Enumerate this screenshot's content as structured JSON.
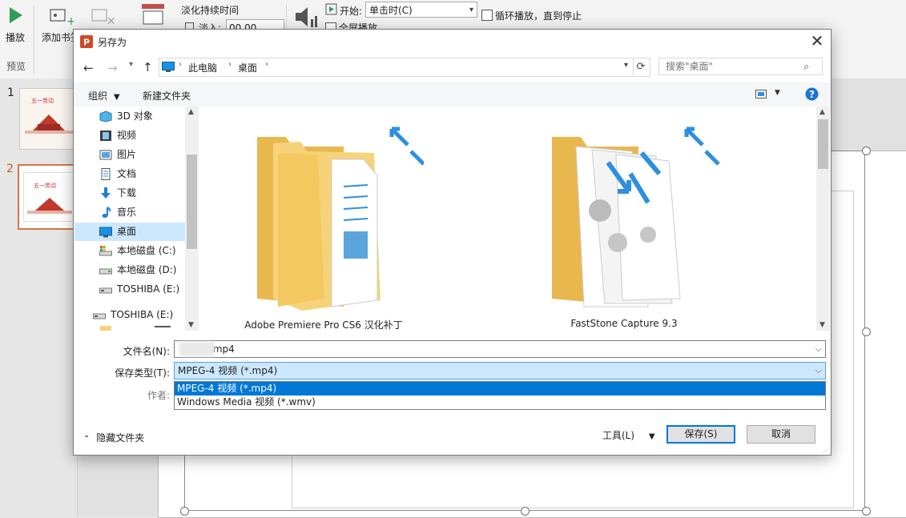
{
  "ribbon": {
    "play_label": "播放",
    "bookmark_label": "添加书签",
    "preview_group": "预览",
    "fade_title": "淡化持续时间",
    "fade_in_label": "淡入:",
    "fade_in_value": "00.00",
    "start_label": "开始:",
    "start_value": "单击时(C)",
    "loop_label": "循环播放，直到停止",
    "fullscreen_label": "全屏播放"
  },
  "slides": {
    "numbers": [
      "1",
      "2"
    ],
    "thumb_text": "五一劳动"
  },
  "dialog": {
    "title": "另存为",
    "close_glyph": "✕",
    "breadcrumb": [
      "此电脑",
      "桌面"
    ],
    "search_placeholder": "搜索\"桌面\"",
    "toolbar": {
      "organize": "组织",
      "new_folder": "新建文件夹"
    },
    "nav_items": [
      {
        "label": "3D 对象",
        "icon": "3d-objects-icon"
      },
      {
        "label": "视频",
        "icon": "video-icon"
      },
      {
        "label": "图片",
        "icon": "pictures-icon"
      },
      {
        "label": "文档",
        "icon": "documents-icon"
      },
      {
        "label": "下载",
        "icon": "downloads-icon"
      },
      {
        "label": "音乐",
        "icon": "music-icon"
      },
      {
        "label": "桌面",
        "icon": "desktop-icon",
        "selected": true
      },
      {
        "label": "本地磁盘 (C:)",
        "icon": "drive-icon"
      },
      {
        "label": "本地磁盘 (D:)",
        "icon": "drive-icon"
      },
      {
        "label": "TOSHIBA (E:)",
        "icon": "usb-drive-icon"
      },
      {
        "label": "TOSHIBA (E:)",
        "icon": "usb-drive-icon"
      }
    ],
    "folders": [
      {
        "name": "Adobe Premiere Pro CS6 汉化补丁",
        "icon": "folder-shortcut-icon"
      },
      {
        "name": "FastStone Capture 9.3",
        "icon": "folder-shortcut-icon"
      }
    ],
    "filename_label": "文件名(N):",
    "filename_value": ".mp4",
    "filetype_label": "保存类型(T):",
    "filetype_value": "MPEG-4 视频 (*.mp4)",
    "filetype_options": [
      "MPEG-4 视频 (*.mp4)",
      "Windows Media 视频 (*.wmv)"
    ],
    "author_label": "作者:",
    "hide_folders": "隐藏文件夹",
    "tools": "工具(L)",
    "save": "保存(S)",
    "cancel": "取消"
  },
  "colors": {
    "selection": "#0078d7",
    "nav_selected": "#cce8ff",
    "folder": "#f6d37a",
    "shortcut_arrow": "#2d8fe0",
    "slide_active_border": "#d7744a"
  }
}
